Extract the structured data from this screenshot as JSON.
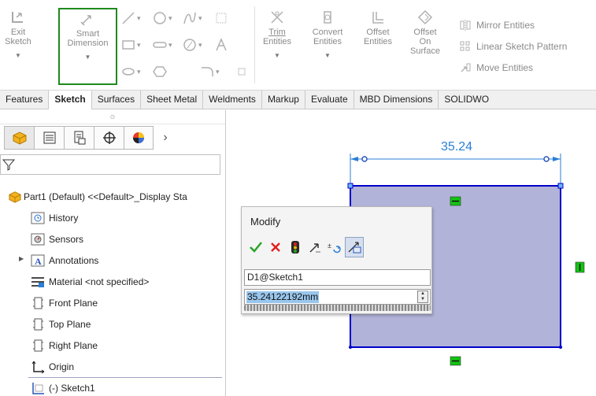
{
  "ribbon": {
    "exit_sketch": "Exit\nSketch",
    "exit_sketch_l1": "Exit",
    "exit_sketch_l2": "Sketch",
    "smart_dim_l1": "Smart",
    "smart_dim_l2": "Dimension",
    "trim_l1": "Trim",
    "trim_l2": "Entities",
    "convert_l1": "Convert",
    "convert_l2": "Entities",
    "offset_l1": "Offset",
    "offset_l2": "Entities",
    "offset_surface_l1": "Offset",
    "offset_surface_l2": "On",
    "offset_surface_l3": "Surface",
    "mirror": "Mirror Entities",
    "linear_pattern": "Linear Sketch Pattern",
    "move": "Move Entities"
  },
  "tabs": [
    "Features",
    "Sketch",
    "Surfaces",
    "Sheet Metal",
    "Weldments",
    "Markup",
    "Evaluate",
    "MBD Dimensions",
    "SOLIDWO"
  ],
  "active_tab": "Sketch",
  "tree": {
    "root": "Part1 (Default) <<Default>_Display Sta",
    "items": [
      {
        "label": "History",
        "icon": "history-icon"
      },
      {
        "label": "Sensors",
        "icon": "sensors-icon"
      },
      {
        "label": "Annotations",
        "icon": "annotations-icon"
      },
      {
        "label": "Material <not specified>",
        "icon": "material-icon"
      },
      {
        "label": "Front Plane",
        "icon": "plane-icon"
      },
      {
        "label": "Top Plane",
        "icon": "plane-icon"
      },
      {
        "label": "Right Plane",
        "icon": "plane-icon"
      },
      {
        "label": "Origin",
        "icon": "origin-icon"
      },
      {
        "label": "(-) Sketch1",
        "icon": "sketch-icon"
      }
    ]
  },
  "canvas": {
    "dimension_label": "35.24"
  },
  "modify": {
    "title": "Modify",
    "dimension_name": "D1@Sketch1",
    "value": "35.24122192mm"
  },
  "colors": {
    "sketch_line": "#0000c8",
    "sketch_fill": "#b1b3d8",
    "dimension": "#2a7fd6",
    "relation_badge": "#12c412",
    "highlight_border": "#1e8a1e"
  }
}
